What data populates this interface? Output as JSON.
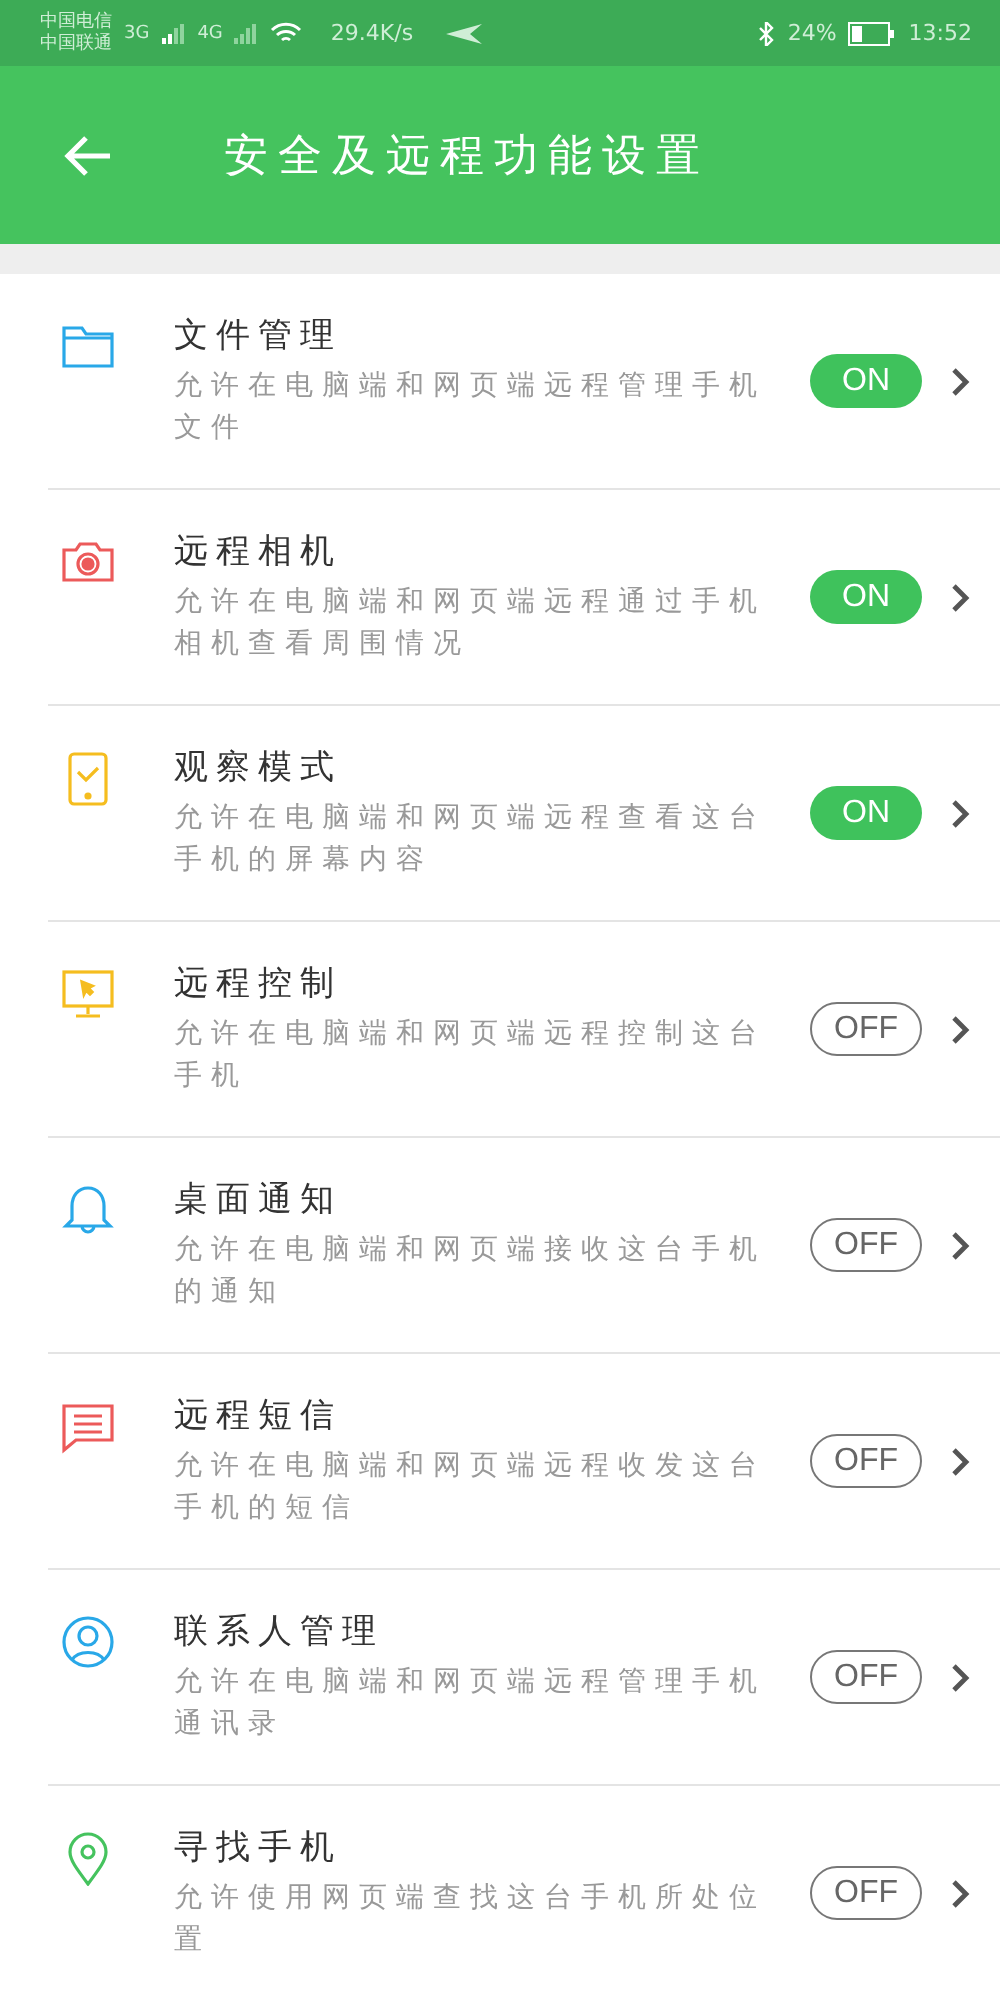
{
  "status_bar": {
    "carriers": [
      "中国电信",
      "中国联通"
    ],
    "network_1": "3G",
    "network_2": "4G",
    "speed": "29.4K/s",
    "battery": "24%",
    "time": "13:52"
  },
  "header": {
    "title": "安全及远程功能设置"
  },
  "settings": [
    {
      "kind": "folder",
      "title": "文件管理",
      "description": "允许在电脑端和网页端远程管理手机文件",
      "on": true,
      "toggle_label": "ON"
    },
    {
      "kind": "camera",
      "title": "远程相机",
      "description": "允许在电脑端和网页端远程通过手机相机查看周围情况",
      "on": true,
      "toggle_label": "ON"
    },
    {
      "kind": "tablet",
      "title": "观察模式",
      "description": "允许在电脑端和网页端远程查看这台手机的屏幕内容",
      "on": true,
      "toggle_label": "ON"
    },
    {
      "kind": "monitor",
      "title": "远程控制",
      "description": "允许在电脑端和网页端远程控制这台手机",
      "on": false,
      "toggle_label": "OFF"
    },
    {
      "kind": "bell",
      "title": "桌面通知",
      "description": "允许在电脑端和网页端接收这台手机的通知",
      "on": false,
      "toggle_label": "OFF"
    },
    {
      "kind": "message",
      "title": "远程短信",
      "description": "允许在电脑端和网页端远程收发这台手机的短信",
      "on": false,
      "toggle_label": "OFF"
    },
    {
      "kind": "contact",
      "title": "联系人管理",
      "description": "允许在电脑端和网页端远程管理手机通讯录",
      "on": false,
      "toggle_label": "OFF"
    },
    {
      "kind": "location",
      "title": "寻找手机",
      "description": "允许使用网页端查找这台手机所处位置",
      "on": false,
      "toggle_label": "OFF"
    }
  ]
}
